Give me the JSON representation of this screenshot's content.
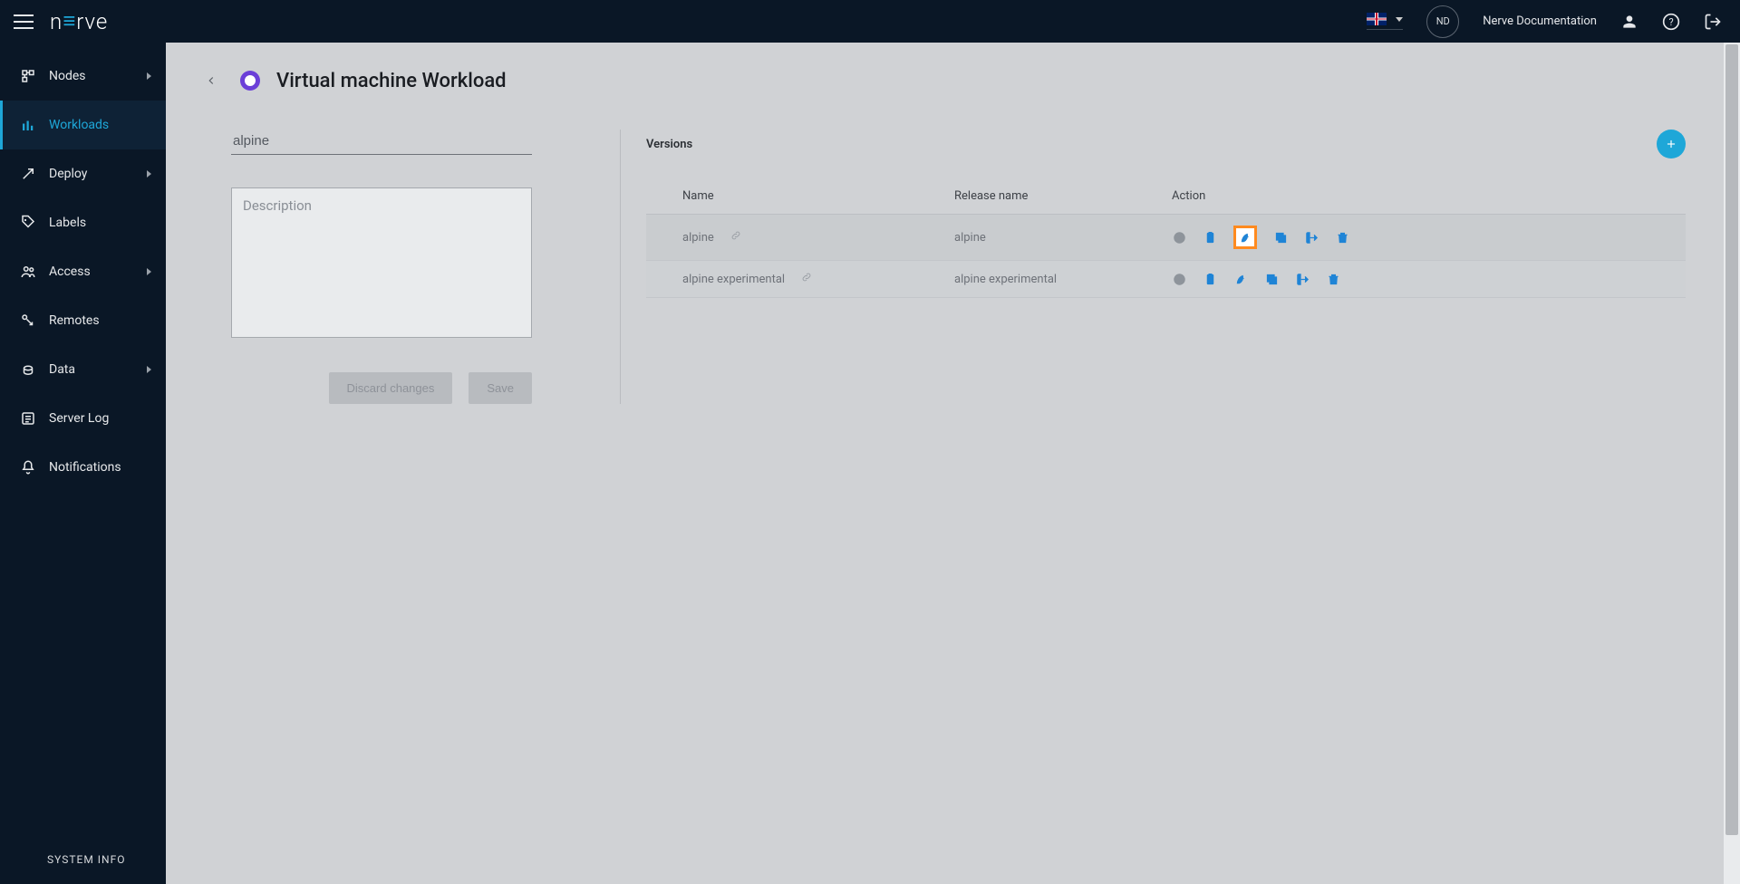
{
  "topbar": {
    "logo_text": "nerve",
    "avatar_initials": "ND",
    "doc_link": "Nerve Documentation"
  },
  "sidebar": {
    "items": [
      {
        "label": "Nodes",
        "icon": "nodes",
        "expandable": true
      },
      {
        "label": "Workloads",
        "icon": "workloads",
        "active": true
      },
      {
        "label": "Deploy",
        "icon": "deploy",
        "expandable": true
      },
      {
        "label": "Labels",
        "icon": "labels"
      },
      {
        "label": "Access",
        "icon": "access",
        "expandable": true
      },
      {
        "label": "Remotes",
        "icon": "remotes"
      },
      {
        "label": "Data",
        "icon": "data",
        "expandable": true
      },
      {
        "label": "Server Log",
        "icon": "serverlog"
      },
      {
        "label": "Notifications",
        "icon": "notifications"
      }
    ],
    "footer": "SYSTEM INFO"
  },
  "page": {
    "title": "Virtual machine Workload",
    "name_value": "alpine",
    "desc_placeholder": "Description",
    "discard_label": "Discard changes",
    "save_label": "Save"
  },
  "versions": {
    "label": "Versions",
    "columns": {
      "name": "Name",
      "release": "Release name",
      "action": "Action"
    },
    "rows": [
      {
        "name": "alpine",
        "release": "alpine",
        "highlight_deploy": true
      },
      {
        "name": "alpine experimental",
        "release": "alpine experimental",
        "highlight_deploy": false
      }
    ]
  }
}
